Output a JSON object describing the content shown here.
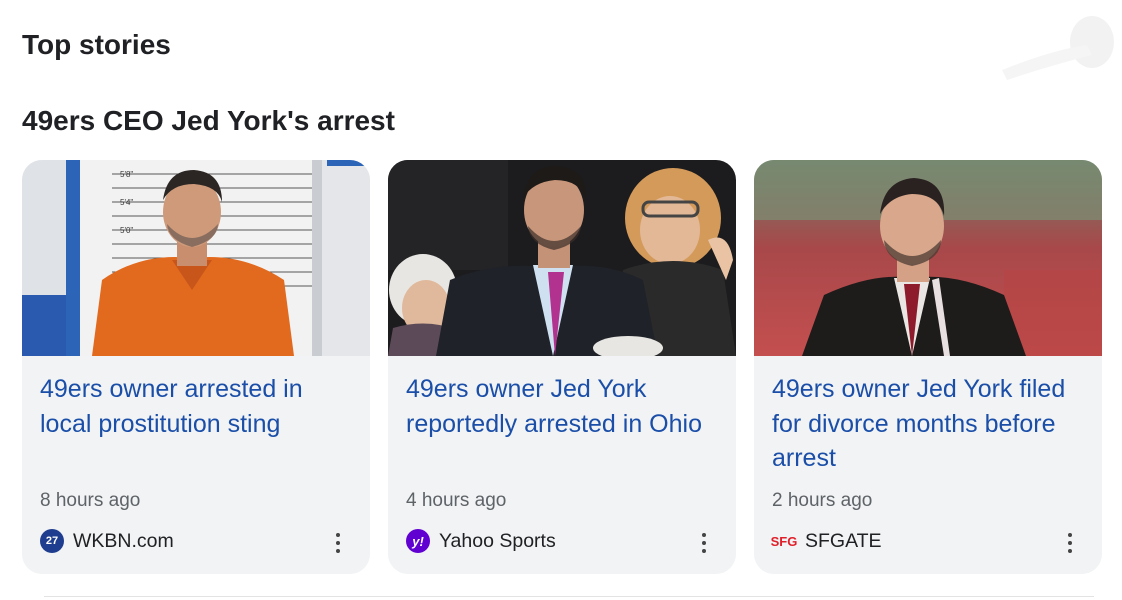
{
  "section": {
    "title": "Top stories"
  },
  "topic": {
    "title": "49ers CEO Jed York's arrest"
  },
  "cards": [
    {
      "headline": "49ers owner arrested in local prostitution sting",
      "age": "8 hours ago",
      "source": "WKBN.com",
      "favicon_text": "27",
      "image": "mugshot-photo",
      "height_chart_labels": [
        "5'8\"",
        "5'4\"",
        "5'0\""
      ]
    },
    {
      "headline": "49ers owner Jed York reportedly arrested in Ohio",
      "age": "4 hours ago",
      "source": "Yahoo Sports",
      "favicon_text": "y!",
      "image": "crowd-photo"
    },
    {
      "headline": "49ers owner Jed York filed for divorce months before arrest",
      "age": "2 hours ago",
      "source": "SFGATE",
      "favicon_text": "SFG",
      "image": "stadium-portrait-photo"
    }
  ],
  "colors": {
    "headline": "#1a4ea8",
    "card_bg": "#f1f3f4",
    "meta": "#5f6368"
  },
  "icons": {
    "more": "more-vert-icon"
  }
}
